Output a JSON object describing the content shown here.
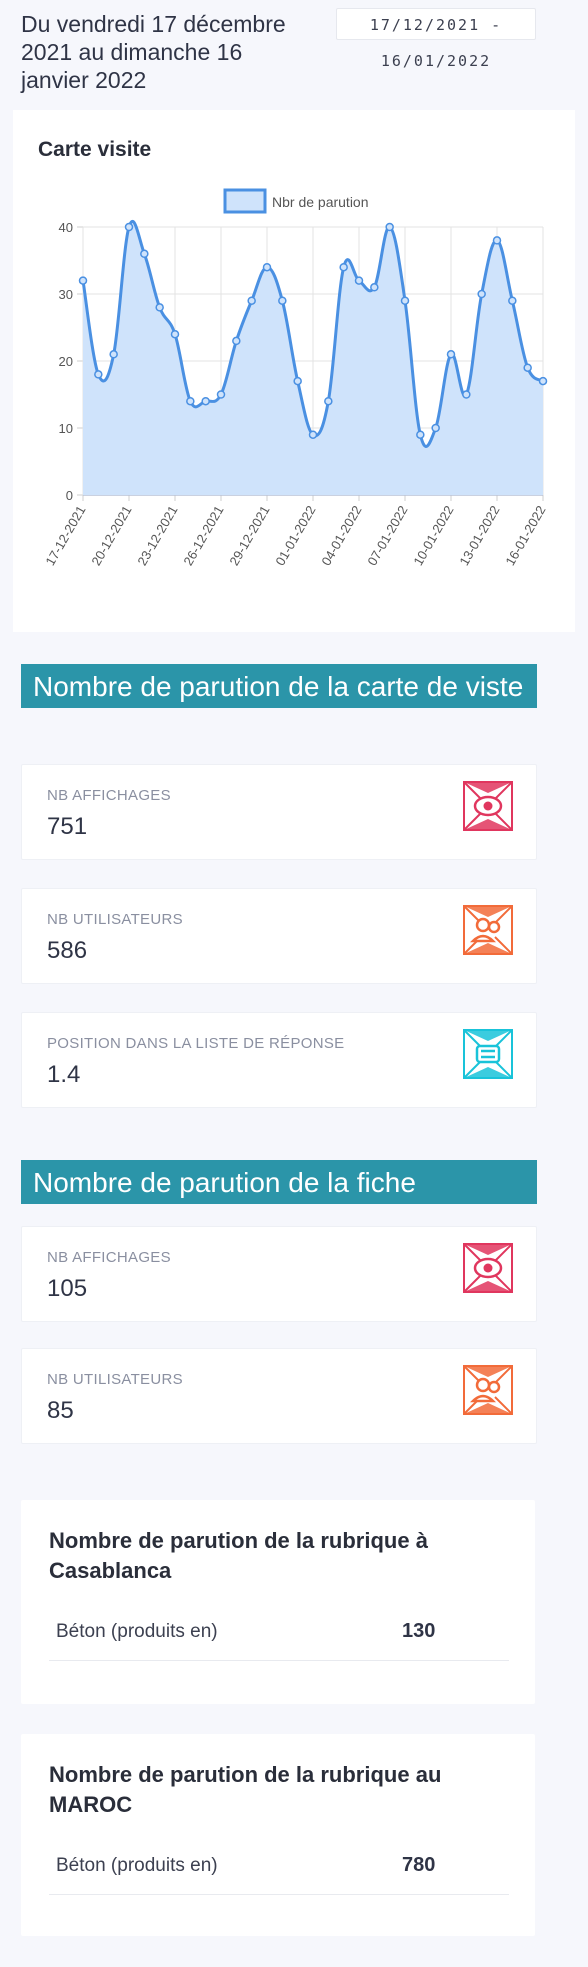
{
  "header": {
    "range_text": "Du vendredi 17 décembre 2021 au dimanche 16 janvier 2022",
    "date_input_line1": "17/12/2021 -",
    "date_input_line2": "16/01/2022"
  },
  "chart_card": {
    "title": "Carte visite"
  },
  "chart_data": {
    "type": "area",
    "title": "",
    "legend": [
      "Nbr de parution"
    ],
    "legend_position": "top",
    "series": [
      {
        "name": "Nbr de parution",
        "color": "#4a90e2",
        "fill": "#cfe3fb",
        "values": [
          32,
          18,
          21,
          40,
          36,
          28,
          24,
          14,
          14,
          15,
          23,
          29,
          34,
          29,
          17,
          9,
          14,
          34,
          32,
          31,
          40,
          29,
          9,
          10,
          21,
          15,
          30,
          38,
          29,
          19,
          17
        ]
      }
    ],
    "x": [
      "17-12-2021",
      "18-12-2021",
      "19-12-2021",
      "20-12-2021",
      "21-12-2021",
      "22-12-2021",
      "23-12-2021",
      "24-12-2021",
      "25-12-2021",
      "26-12-2021",
      "27-12-2021",
      "28-12-2021",
      "29-12-2021",
      "30-12-2021",
      "31-12-2021",
      "01-01-2022",
      "02-01-2022",
      "03-01-2022",
      "04-01-2022",
      "05-01-2022",
      "06-01-2022",
      "07-01-2022",
      "08-01-2022",
      "09-01-2022",
      "10-01-2022",
      "11-01-2022",
      "12-01-2022",
      "13-01-2022",
      "14-01-2022",
      "15-01-2022",
      "16-01-2022"
    ],
    "x_tick_labels": [
      "17-12-2021",
      "20-12-2021",
      "23-12-2021",
      "26-12-2021",
      "29-12-2021",
      "01-01-2022",
      "04-01-2022",
      "07-01-2022",
      "10-01-2022",
      "13-01-2022",
      "16-01-2022"
    ],
    "y_ticks": [
      "0",
      "10",
      "20",
      "30",
      "40"
    ],
    "ylim": [
      0,
      40
    ],
    "grid": true
  },
  "section_carte": {
    "title": "Nombre de parution de la carte de viste",
    "stats": [
      {
        "label": "NB AFFICHAGES",
        "value": "751",
        "icon": "eye-icon",
        "color": "#e0365e"
      },
      {
        "label": "NB UTILISATEURS",
        "value": "586",
        "icon": "users-icon",
        "color": "#f26b3a"
      },
      {
        "label": "POSITION DANS LA LISTE DE RÉPONSE",
        "value": "1.4",
        "icon": "list-position-icon",
        "color": "#19c3d9"
      }
    ]
  },
  "section_fiche": {
    "title": "Nombre de parution de la fiche",
    "stats": [
      {
        "label": "NB AFFICHAGES",
        "value": "105",
        "icon": "eye-icon",
        "color": "#e0365e"
      },
      {
        "label": "NB UTILISATEURS",
        "value": "85",
        "icon": "users-icon",
        "color": "#f26b3a"
      }
    ]
  },
  "rubrique_casablanca": {
    "title": "Nombre de parution de la rubrique à Casablanca",
    "rows": [
      {
        "name": "Béton (produits en)",
        "value": "130"
      }
    ]
  },
  "rubrique_maroc": {
    "title": "Nombre de parution de la rubrique au MAROC",
    "rows": [
      {
        "name": "Béton (produits en)",
        "value": "780"
      }
    ]
  }
}
